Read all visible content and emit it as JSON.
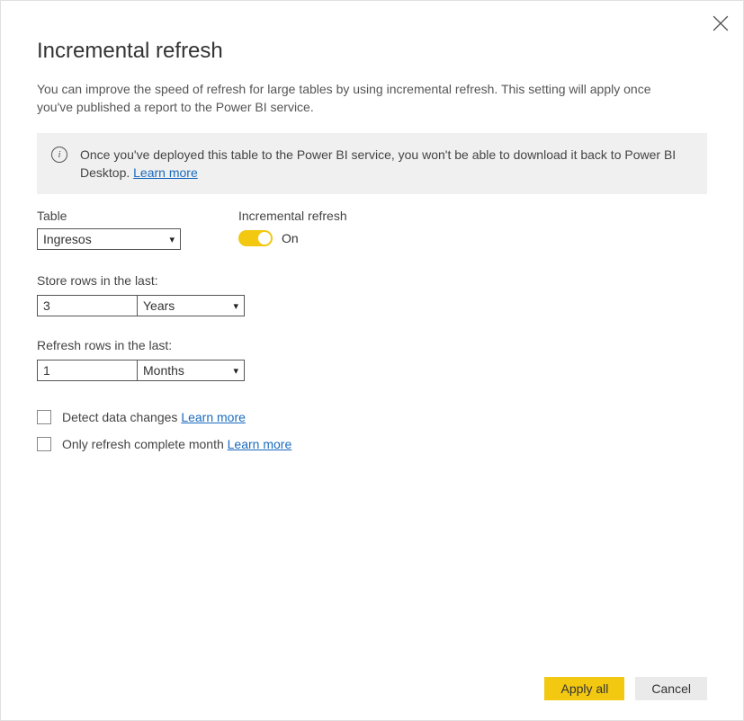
{
  "dialog": {
    "title": "Incremental refresh",
    "subtitle": "You can improve the speed of refresh for large tables by using incremental refresh. This setting will apply once you've published a report to the Power BI service."
  },
  "banner": {
    "text": "Once you've deployed this table to the Power BI service, you won't be able to download it back to Power BI Desktop. ",
    "learn_more": "Learn more"
  },
  "table_field": {
    "label": "Table",
    "value": "Ingresos"
  },
  "toggle_field": {
    "label": "Incremental refresh",
    "state_label": "On"
  },
  "store_rows": {
    "label": "Store rows in the last:",
    "value": "3",
    "unit": "Years"
  },
  "refresh_rows": {
    "label": "Refresh rows in the last:",
    "value": "1",
    "unit": "Months"
  },
  "detect": {
    "label": "Detect data changes ",
    "learn_more": "Learn more"
  },
  "complete": {
    "label": "Only refresh complete month ",
    "learn_more": "Learn more"
  },
  "buttons": {
    "apply": "Apply all",
    "cancel": "Cancel"
  }
}
